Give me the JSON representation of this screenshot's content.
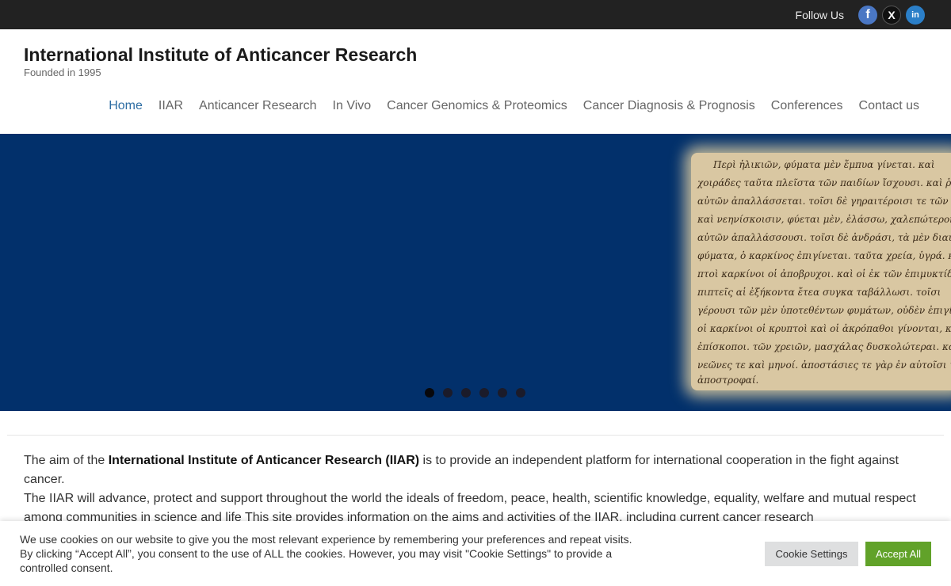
{
  "topbar": {
    "follow_label": "Follow Us",
    "social": [
      {
        "icon": "facebook-icon",
        "glyph": "f"
      },
      {
        "icon": "x-icon",
        "glyph": "X"
      },
      {
        "icon": "linkedin-icon",
        "glyph": "in"
      }
    ]
  },
  "header": {
    "title": "International Institute of Anticancer Research",
    "tagline": "Founded in 1995"
  },
  "nav": [
    {
      "label": "Home",
      "active": true
    },
    {
      "label": "IIAR"
    },
    {
      "label": "Anticancer Research"
    },
    {
      "label": "In Vivo"
    },
    {
      "label": "Cancer Genomics & Proteomics"
    },
    {
      "label": "Cancer Diagnosis & Prognosis"
    },
    {
      "label": "Conferences"
    },
    {
      "label": "Contact us"
    }
  ],
  "hero": {
    "background": "#02306b",
    "manuscript_lines": [
      "Περὶ ἡλικιῶν, φύματα μὲν ἔμπυα γίνεται. καὶ",
      "χοιράδες ταῦτα πλεῖστα τῶν παιδίων ἴσχουσι. καὶ ῥᾷστα",
      "αὐτῶν ἀπαλλάσσεται. τοῖσι δὲ γηραιτέροισι τε τῶν παιδίων",
      "καὶ νεηνίσκοισιν, φύεται μὲν, ἐλάσσω, χαλεπώτερον δὲ",
      "αὐτῶν ἀπαλλάσσουσι. τοῖσι δὲ ἀνδράσι, τὰ μὲν διαιτ",
      "φύματα, ὁ καρκίνος ἐπιγίνεται. ταῦτα χρεία, ὑγρά. καὶ κρυ",
      "πτοὶ καρκίνοι οἱ ἀποβρυχοι. καὶ οἱ ἐκ τῶν ἐπιμυκτίδων",
      "πιπτεῖς αἱ ἐξήκοντα ἔτεα συγκα ταβάλλωσι. τοῖσι",
      "γέρουσι τῶν μὲν ὑποτεθέντων φυμάτων, οὐδὲν ἐπιγίνεται.",
      "οἱ καρκίνοι οἱ κρυπτοὶ καὶ οἱ ἀκρόπαθοι γίνονται, καὶ",
      "ἐπίσκοποι. τῶν χρειῶν, μασχάλας δυσκολώτεραι. καὶ",
      "νεῶνες τε καὶ μηνοί. ἀποστάσιες τε γὰρ ἐν αὐτοῖσι γίνονται,",
      "ἀποστροφαί."
    ],
    "slide_count": 6,
    "active_slide": 0
  },
  "intro": {
    "p1_before": "The aim of the ",
    "p1_bold": "International Institute of Anticancer Research (IIAR)",
    "p1_after": " is to provide an independent platform for international cooperation in the fight against cancer.",
    "p2": "The IIAR will advance, protect and support throughout the world the ideals of freedom, peace, health, scientific knowledge, equality, welfare and mutual respect among communities in science and life This site provides information on the aims and activities of the IIAR, including current cancer research"
  },
  "cookie": {
    "text": "We use cookies on our website to give you the most relevant experience by remembering your preferences and repeat visits. By clicking “Accept All”, you consent to the use of ALL the cookies. However, you may visit \"Cookie Settings\" to provide a controlled consent.",
    "settings_label": "Cookie Settings",
    "accept_label": "Accept All",
    "accept_color": "#61a229"
  }
}
